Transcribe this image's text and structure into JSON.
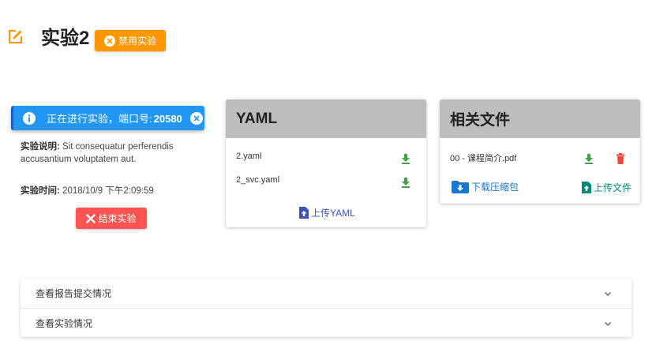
{
  "header": {
    "title": "实验2",
    "disable_label": "禁用实验",
    "colors": {
      "edit_icon": "#ff9800",
      "disable_button": "#ff9800"
    }
  },
  "status": {
    "message": "正在进行实验，端口号:",
    "port": "20580",
    "color": "#2196f3"
  },
  "info": {
    "desc_label": "实验说明:",
    "desc_text": "Sit consequatur perferendis accusantium voluptatem aut.",
    "time_label": "实验时间:",
    "time_value": "2018/10/9 下午2:09:59",
    "end_label": "结束实验",
    "end_color": "#ff5252"
  },
  "yaml_card": {
    "title": "YAML",
    "files": [
      "2.yaml",
      "2_svc.yaml"
    ],
    "upload_label": "上传YAML",
    "upload_color": "#3f51b5"
  },
  "files_card": {
    "title": "相关文件",
    "files": [
      "00 - 课程简介.pdf"
    ],
    "download_zip_label": "下载压缩包",
    "upload_label": "上传文件",
    "download_color": "#1976d2",
    "upload_color": "#00897b"
  },
  "accordion": {
    "items": [
      "查看报告提交情况",
      "查看实验情况"
    ]
  },
  "icons": {
    "download": "download-icon",
    "delete": "delete-icon",
    "chevron": "chevron-down-icon"
  }
}
